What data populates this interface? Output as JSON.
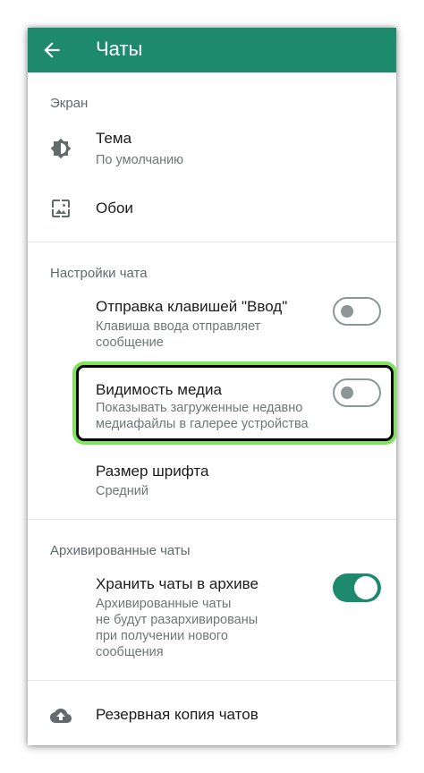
{
  "appbar": {
    "title": "Чаты",
    "back_icon": "arrow-left-icon",
    "background": "#1d8a6d"
  },
  "sections": {
    "screen": {
      "header": "Экран",
      "theme": {
        "title": "Тема",
        "subtitle": "По умолчанию",
        "icon": "brightness-icon"
      },
      "wallpaper": {
        "title": "Обои",
        "icon": "wallpaper-icon"
      }
    },
    "chat_settings": {
      "header": "Настройки чата",
      "enter_send": {
        "title": "Отправка клавишей \"Ввод\"",
        "subtitle_line1": "Клавиша ввода отправляет",
        "subtitle_line2": "сообщение",
        "enabled": false
      },
      "media_visibility": {
        "title": "Видимость медиа",
        "subtitle_line1": "Показывать загруженные недавно",
        "subtitle_line2": "медиафайлы в галерее устройства",
        "enabled": false
      },
      "font_size": {
        "title": "Размер шрифта",
        "subtitle": "Средний"
      }
    },
    "archived": {
      "header": "Архивированные чаты",
      "keep_archived": {
        "title": "Хранить чаты в архиве",
        "subtitle_line1": "Архивированные чаты",
        "subtitle_line2": "не будут разархивированы",
        "subtitle_line3": "при получении нового",
        "subtitle_line4": "сообщения",
        "enabled": true
      }
    },
    "backup": {
      "title": "Резервная копия чатов",
      "icon": "cloud-upload-icon"
    }
  },
  "colors": {
    "accent": "#1d8a6d",
    "highlight": "#7fe45a"
  }
}
